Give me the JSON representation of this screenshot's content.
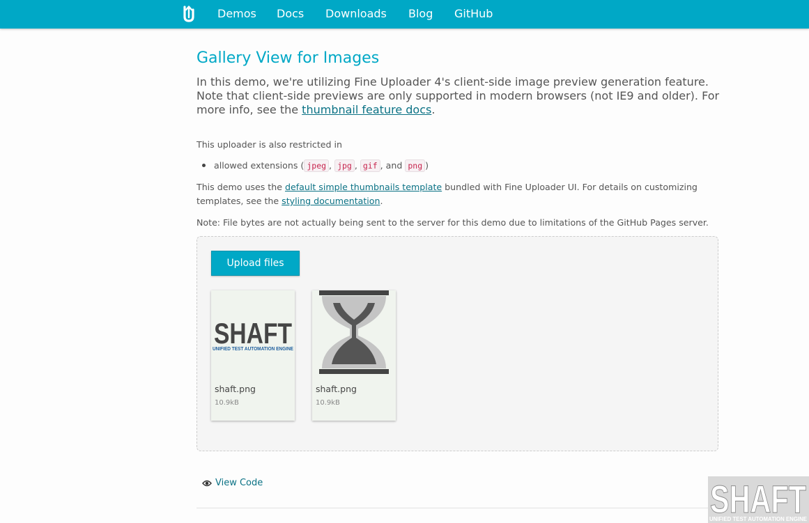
{
  "nav": {
    "logo_icon": "fine-uploader-logo-icon",
    "links": [
      "Demos",
      "Docs",
      "Downloads",
      "Blog",
      "GitHub"
    ]
  },
  "page": {
    "title": "Gallery View for Images",
    "lead_text": "In this demo, we're utilizing Fine Uploader 4's client-side image preview generation feature. Note that client-side previews are only supported in modern browsers (not IE9 and older). For more info, see the ",
    "lead_link": "thumbnail feature docs",
    "lead_end": ".",
    "restrict_text": "This uploader is also restricted in",
    "ext_prefix": "allowed extensions (",
    "extensions": [
      "jpeg",
      "jpg",
      "gif",
      "png"
    ],
    "ext_sep": ", ",
    "ext_and": ", and ",
    "ext_suffix": ")",
    "template_text_1": "This demo uses the ",
    "template_link": "default simple thumbnails template",
    "template_text_2": " bundled with Fine Uploader UI. For details on customizing templates, see the ",
    "styling_link": "styling documentation",
    "template_text_3": ".",
    "note": "Note: File bytes are not actually being sent to the server for this demo due to limitations of the GitHub Pages server."
  },
  "uploader": {
    "button_label": "Upload files",
    "files": [
      {
        "name": "shaft.png",
        "size": "10.9kB",
        "thumb": "shaft-logo",
        "logo_word": "SHAFT",
        "logo_sub": "UNIFIED TEST AUTOMATION ENGINE"
      },
      {
        "name": "shaft.png",
        "size": "10.9kB",
        "thumb": "hourglass-icon"
      }
    ]
  },
  "view_code": {
    "icon": "eye-icon",
    "label": "View Code"
  },
  "watermark": {
    "word": "SHAFT",
    "sub": "UNIFIED TEST AUTOMATION ENGINE"
  },
  "colors": {
    "accent": "#00a8c6",
    "link": "#0b7285",
    "code": "#c7254e",
    "logo_blue": "#1f5f9e"
  }
}
